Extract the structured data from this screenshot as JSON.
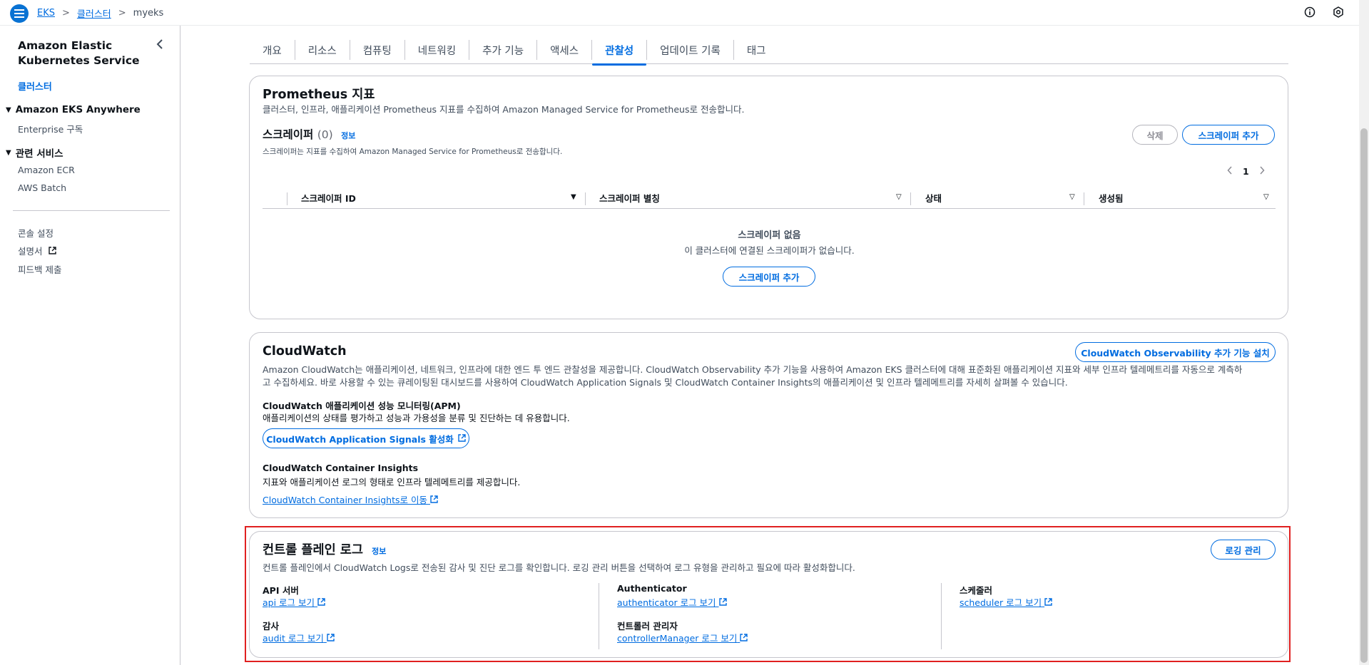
{
  "breadcrumb": {
    "items": [
      "EKS",
      "클러스터"
    ],
    "current": "myeks",
    "separator": ">"
  },
  "sidebar": {
    "title": "Amazon Elastic Kubernetes Service",
    "active_link": "클러스터",
    "section1": "Amazon EKS Anywhere",
    "section1_item": "Enterprise 구독",
    "section2": "관련 서비스",
    "section2_items": [
      "Amazon ECR",
      "AWS Batch"
    ],
    "footer_items": [
      "콘솔 설정",
      "설명서",
      "피드백 제출"
    ]
  },
  "tabs": [
    "개요",
    "리소스",
    "컴퓨팅",
    "네트워킹",
    "추가 기능",
    "액세스",
    "관찰성",
    "업데이트 기록",
    "태그"
  ],
  "active_tab": "관찰성",
  "prometheus": {
    "title": "Prometheus 지표",
    "desc": "클러스터, 인프라, 애플리케이션 Prometheus 지표를 수집하여 Amazon Managed Service for Prometheus로 전송합니다.",
    "scraper_title": "스크레이퍼",
    "scraper_count": "(0)",
    "info": "정보",
    "scraper_desc": "스크레이퍼는 지표를 수집하여 Amazon Managed Service for Prometheus로 전송합니다.",
    "delete_btn": "삭제",
    "add_btn": "스크레이퍼 추가",
    "page": "1",
    "columns": [
      "스크레이퍼 ID",
      "스크레이퍼 별칭",
      "상태",
      "생성됨"
    ],
    "empty_title": "스크레이퍼 없음",
    "empty_desc": "이 클러스터에 연결된 스크레이퍼가 없습니다.",
    "empty_btn": "스크레이퍼 추가"
  },
  "cloudwatch": {
    "title": "CloudWatch",
    "install_btn": "CloudWatch Observability 추가 기능 설치",
    "desc1": "Amazon CloudWatch는 애플리케이션, 네트워크, 인프라에 대한 엔드 투 엔드 관찰성을 제공합니다. CloudWatch Observability 추가 기능을 사용하여 Amazon EKS 클러스터에 대해 표준화된 애플리케이션 지표와 세부 인프라 텔레메트리를 자동으로 계측하",
    "desc2": "고 수집하세요. 바로 사용할 수 있는 큐레이팅된 대시보드를 사용하여 CloudWatch Application Signals 및 CloudWatch Container Insights의 애플리케이션 및 인프라 텔레메트리를 자세히 살펴볼 수 있습니다.",
    "apm_title": "CloudWatch 애플리케이션 성능 모니터링(APM)",
    "apm_desc": "애플리케이션의 상태를 평가하고 성능과 가용성을 분류 및 진단하는 데 유용합니다.",
    "apm_btn": "CloudWatch Application Signals 활성화",
    "ci_title": "CloudWatch Container Insights",
    "ci_desc": "지표와 애플리케이션 로그의 형태로 인프라 텔레메트리를 제공합니다.",
    "ci_link": "CloudWatch Container Insights로 이동"
  },
  "control_plane": {
    "title": "컨트롤 플레인 로그",
    "info": "정보",
    "desc": "컨트롤 플레인에서 CloudWatch Logs로 전송된 감사 및 진단 로그를 확인합니다. 로깅 관리 버튼을 선택하여 로그 유형을 관리하고 필요에 따라 활성화합니다.",
    "manage_btn": "로깅 관리",
    "api_label": "API 서버",
    "api_link": "api 로그 보기",
    "auth_label": "Authenticator",
    "auth_link": "authenticator 로그 보기",
    "sched_label": "스케줄러",
    "sched_link": "scheduler 로그 보기",
    "audit_label": "감사",
    "audit_link": "audit 로그 보기",
    "cm_label": "컨트롤러 관리자",
    "cm_link": "controllerManager 로그 보기"
  }
}
